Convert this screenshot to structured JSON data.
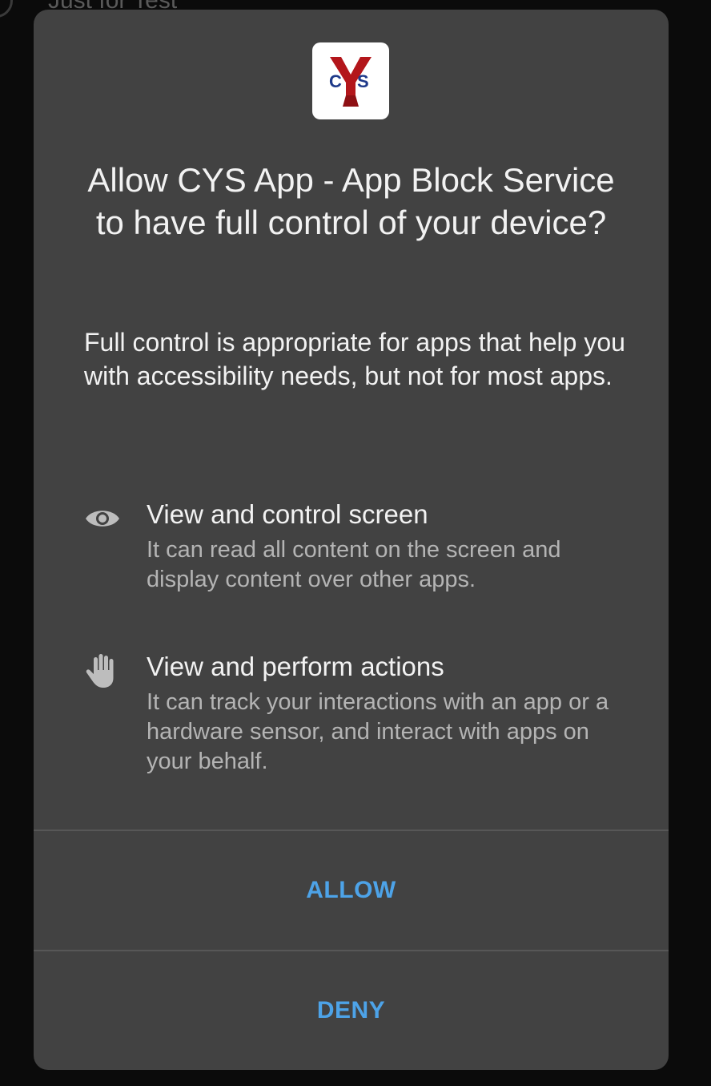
{
  "background": {
    "partial_text": "Just for Test"
  },
  "dialog": {
    "app_icon": {
      "icon": "cys-logo-icon",
      "logo_text": "CYS"
    },
    "title": "Allow CYS App - App Block Service to have full control of your device?",
    "description": "Full control is appropriate for apps that help you with accessibility needs, but not for most apps.",
    "permissions": [
      {
        "icon": "eye-icon",
        "title": "View and control screen",
        "description": "It can read all content on the screen and display content over other apps."
      },
      {
        "icon": "hand-icon",
        "title": "View and perform actions",
        "description": "It can track your interactions with an app or a hardware sensor, and interact with apps on your behalf."
      }
    ],
    "buttons": {
      "allow": "ALLOW",
      "deny": "DENY"
    }
  },
  "colors": {
    "dialog_background": "#424242",
    "button_text": "#4da3e8",
    "primary_text": "#f2f2f2",
    "secondary_text": "#b4b4b4"
  }
}
